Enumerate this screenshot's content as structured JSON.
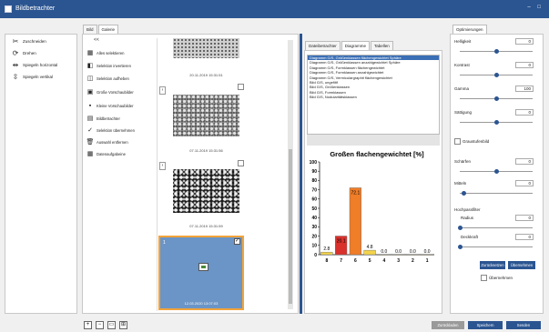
{
  "window": {
    "title": "Bildbetrachter",
    "controls": "– □"
  },
  "left_tools": [
    {
      "label": "Zuschneiden",
      "icon": "scissors-icon"
    },
    {
      "label": "Drehen",
      "icon": "rotate-icon"
    },
    {
      "label": "Spiegeln horizontal",
      "icon": "flip-horizontal-icon"
    },
    {
      "label": "Spiegeln vertikal",
      "icon": "flip-vertical-icon"
    }
  ],
  "middle_tabs": [
    "Bild",
    "Galerie"
  ],
  "gallery_nav": "<<",
  "gallery_actions": [
    {
      "label": "Alles selektieren",
      "icon": "select-all-icon"
    },
    {
      "label": "Selektion invertieren",
      "icon": "invert-selection-icon"
    },
    {
      "label": "Selektion aufheben",
      "icon": "deselect-icon"
    },
    {
      "label": "Große Vorschaubilder",
      "icon": "large-thumbnails-icon"
    },
    {
      "label": "Kleine Vorschaubilder",
      "icon": "small-thumbnails-icon"
    },
    {
      "label": "Bildbetrachter",
      "icon": "viewer-icon"
    },
    {
      "label": "Selektion übernehmen",
      "icon": "check-icon"
    },
    {
      "label": "Auswahl entfernen",
      "icon": "trash-icon"
    },
    {
      "label": "Datenaufgabeine",
      "icon": "data-icon"
    }
  ],
  "thumbnails": [
    {
      "date": "20.11.2019 15:31:51"
    },
    {
      "date": "07.11.2019 15:31:56"
    },
    {
      "date": "07.11.2019 15:31:59"
    },
    {
      "index": "1",
      "date": "12.03.2020 13:07:03"
    }
  ],
  "analysis_tabs": [
    "Dateibetrachter",
    "Diagramme",
    "Tabellen"
  ],
  "diagram_list": [
    "Diagramm G/S, Größenklassen flächengewichtet Sphäre",
    "Diagramm G/S, Größenklassen anzahlgewichtet Sphäre",
    "Diagramm G/S, Formklassen flächengewichtet",
    "Diagramm G/S, Formklassen anzahlgewichtet",
    "Diagramm G/S, Vermiculargraphit flächengewichtet",
    "Bild G/S, ungefiltf",
    "Bild G/S, Größenklassen",
    "Bild G/S, Formklassen",
    "Bild G/S, Nodularitätsklassen"
  ],
  "chart_data": {
    "type": "bar",
    "title": "Großen flachengewichtet [%]",
    "categories": [
      "8",
      "7",
      "6",
      "5",
      "4",
      "3",
      "2",
      "1"
    ],
    "values": [
      2.8,
      20.1,
      72.1,
      4.8,
      0.0,
      0.0,
      0.0,
      0.0
    ],
    "labels": [
      "2.8",
      "20.1",
      "72.1",
      "4.8",
      "0.0",
      "0.0",
      "0.0",
      "0.0"
    ],
    "ylim": [
      0,
      100
    ],
    "yticks": [
      "100",
      "90",
      "80",
      "70",
      "60",
      "50",
      "40",
      "30",
      "20",
      "10",
      "0"
    ],
    "colors": [
      "#f3d34a",
      "#d9312c",
      "#f07d28",
      "#f3d34a",
      "#f3d34a",
      "#f3d34a",
      "#f3d34a",
      "#f3d34a"
    ]
  },
  "right_panel": {
    "title": "Optimierungen",
    "rows": [
      {
        "label": "Helligkeit",
        "value": "0",
        "level": 0.5
      },
      {
        "label": "Kontrast",
        "value": "0",
        "level": 0.5
      },
      {
        "label": "Gamma",
        "value": "100",
        "level": 0.5
      },
      {
        "label": "Sättigung",
        "value": "0",
        "level": 0.5
      }
    ],
    "grayscale_label": "Graustufenbild",
    "rows2": [
      {
        "label": "Schärfen",
        "value": "0",
        "level": 0.5
      },
      {
        "label": "Mitteln",
        "value": "0",
        "level": 0.05
      }
    ],
    "highpass_title": "Hochpassfilter",
    "rows3": [
      {
        "label": "Radius",
        "value": "0",
        "level": 0.0
      },
      {
        "label": "Deckkraft",
        "value": "0",
        "level": 0.0
      }
    ],
    "reset_label": "Zurücksetzen",
    "apply_label": "Übernehmen",
    "take_label": "Übernehmen"
  },
  "bottom_tools": [
    "+",
    "−",
    "▭",
    "⊞"
  ],
  "footer": {
    "back_label": "Zurückladen",
    "save_label": "Speichern",
    "send_label": "Senden"
  }
}
